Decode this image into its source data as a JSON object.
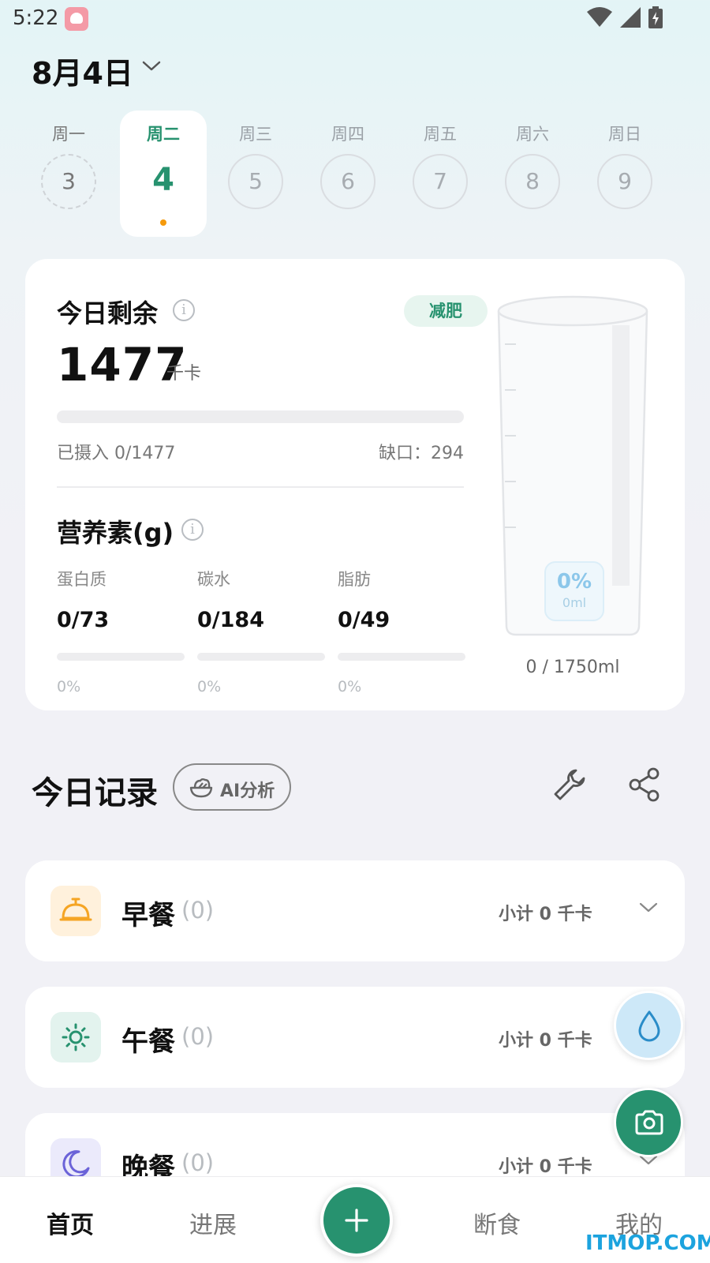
{
  "status_bar": {
    "time": "5:22"
  },
  "header": {
    "date": "8月4日"
  },
  "week": [
    {
      "name": "周一",
      "num": "3",
      "state": "dashed"
    },
    {
      "name": "周二",
      "num": "4",
      "state": "active"
    },
    {
      "name": "周三",
      "num": "5",
      "state": ""
    },
    {
      "name": "周四",
      "num": "6",
      "state": ""
    },
    {
      "name": "周五",
      "num": "7",
      "state": ""
    },
    {
      "name": "周六",
      "num": "8",
      "state": ""
    },
    {
      "name": "周日",
      "num": "9",
      "state": ""
    }
  ],
  "summary": {
    "remain_label": "今日剩余",
    "goal_badge": "减肥",
    "remain_value": "1477",
    "remain_unit": "千卡",
    "intake_label": "已摄入 0/1477",
    "intake_progress": 0,
    "deficit_label": "缺口：294",
    "nutrients_title": "营养素(g)",
    "nutrients": [
      {
        "label": "蛋白质",
        "value": "0/73",
        "percent": "0%",
        "progress": 0
      },
      {
        "label": "碳水",
        "value": "0/184",
        "percent": "0%",
        "progress": 0
      },
      {
        "label": "脂肪",
        "value": "0/49",
        "percent": "0%",
        "progress": 0
      }
    ]
  },
  "water": {
    "percent": "0%",
    "amount": "0ml",
    "total": "0 / 1750ml"
  },
  "records": {
    "title": "今日记录",
    "ai_button": "AI分析",
    "meals": [
      {
        "name": "早餐",
        "count": "(0)",
        "subtotal": "小计 0 千卡",
        "icon": "bell-icon",
        "icon_bg": "#fff1dc",
        "icon_color": "#f5a524"
      },
      {
        "name": "午餐",
        "count": "(0)",
        "subtotal": "小计 0 千卡",
        "icon": "sun-icon",
        "icon_bg": "#e3f3ee",
        "icon_color": "#27926f"
      },
      {
        "name": "晚餐",
        "count": "(0)",
        "subtotal": "小计 0 千卡",
        "icon": "moon-icon",
        "icon_bg": "#ebeafb",
        "icon_color": "#6b63d8"
      }
    ]
  },
  "nav": [
    {
      "label": "首页",
      "active": true
    },
    {
      "label": "进展",
      "active": false
    },
    {
      "label": "断食",
      "active": false
    },
    {
      "label": "我的",
      "active": false
    }
  ],
  "watermark": "ITMOP.COM",
  "colors": {
    "accent": "#27926f",
    "dot": "#f59a0c",
    "water": "#8cc7ea"
  }
}
